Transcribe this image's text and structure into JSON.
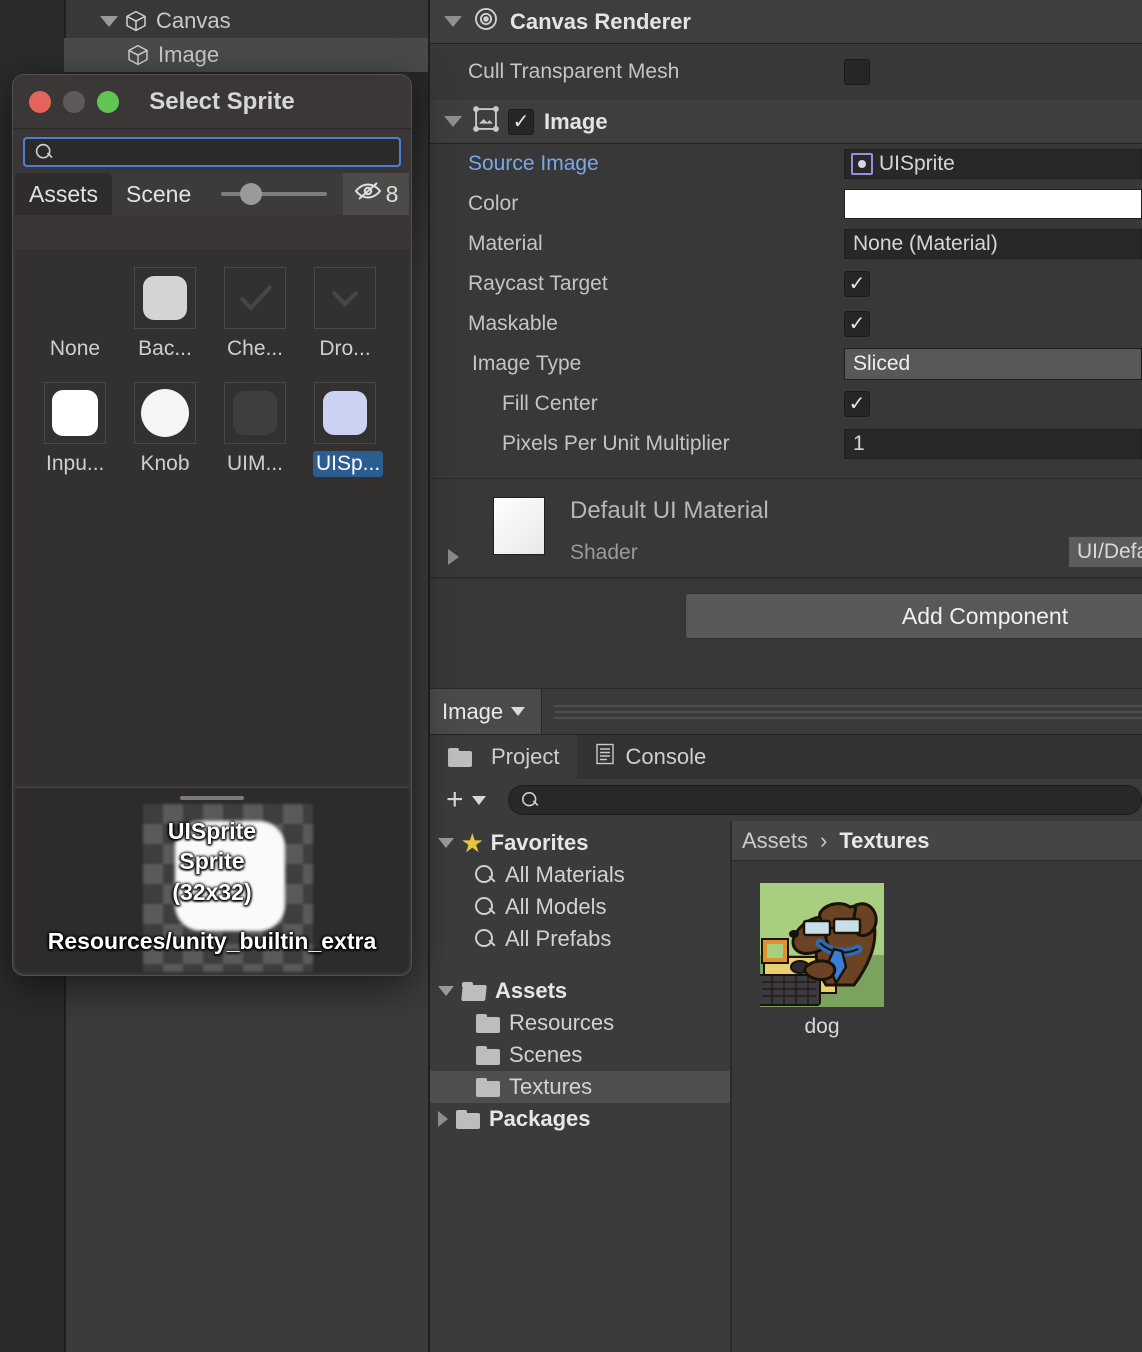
{
  "hierarchy": {
    "items": [
      {
        "label": "Canvas",
        "icon": "cube-icon",
        "expanded": true,
        "selected": false
      },
      {
        "label": "Image",
        "icon": "cube-icon",
        "expanded": false,
        "selected": true
      }
    ]
  },
  "inspector": {
    "canvas_renderer": {
      "title": "Canvas Renderer",
      "icon": "canvas-renderer-icon",
      "rows": [
        {
          "label": "Cull Transparent Mesh",
          "checked": false
        }
      ]
    },
    "image_component": {
      "title": "Image",
      "icon": "image-component-icon",
      "enabled": true,
      "source_image_label": "Source Image",
      "source_image_value": "UISprite",
      "color_label": "Color",
      "color_value": "#FFFFFF",
      "material_label": "Material",
      "material_value": "None (Material)",
      "raycast_target_label": "Raycast Target",
      "raycast_target_checked": true,
      "maskable_label": "Maskable",
      "maskable_checked": true,
      "image_type_label": "Image Type",
      "image_type_value": "Sliced",
      "fill_center_label": "Fill Center",
      "fill_center_checked": true,
      "ppu_label": "Pixels Per Unit Multiplier",
      "ppu_value": "1"
    },
    "material_preview": {
      "name": "Default UI Material",
      "shader_label": "Shader",
      "shader_value": "UI/Default"
    },
    "add_component_label": "Add Component",
    "footer_dropdown_label": "Image"
  },
  "project": {
    "tabs": [
      {
        "label": "Project",
        "icon": "folder-icon",
        "active": true
      },
      {
        "label": "Console",
        "icon": "console-icon",
        "active": false
      }
    ],
    "create_label": "+",
    "search_placeholder": "",
    "tree": [
      {
        "label": "Favorites",
        "icon": "star-icon",
        "arrow": "down",
        "indent": 0,
        "bold": true,
        "selected": false
      },
      {
        "label": "All Materials",
        "icon": "search-icon",
        "arrow": "none",
        "indent": 1,
        "bold": false,
        "selected": false
      },
      {
        "label": "All Models",
        "icon": "search-icon",
        "arrow": "none",
        "indent": 1,
        "bold": false,
        "selected": false
      },
      {
        "label": "All Prefabs",
        "icon": "search-icon",
        "arrow": "none",
        "indent": 1,
        "bold": false,
        "selected": false
      },
      {
        "label": "Assets",
        "icon": "folder-open-icon",
        "arrow": "down",
        "indent": 0,
        "bold": true,
        "selected": false
      },
      {
        "label": "Resources",
        "icon": "folder-icon",
        "arrow": "none",
        "indent": 1,
        "bold": false,
        "selected": false
      },
      {
        "label": "Scenes",
        "icon": "folder-icon",
        "arrow": "none",
        "indent": 1,
        "bold": false,
        "selected": false
      },
      {
        "label": "Textures",
        "icon": "folder-icon",
        "arrow": "none",
        "indent": 1,
        "bold": false,
        "selected": true
      },
      {
        "label": "Packages",
        "icon": "folder-icon",
        "arrow": "right",
        "indent": 0,
        "bold": true,
        "selected": false
      }
    ],
    "breadcrumb": {
      "root": "Assets",
      "separator": "›",
      "current": "Textures"
    },
    "assets": [
      {
        "name": "dog",
        "icon": "dog-thumbnail"
      }
    ]
  },
  "select_sprite_modal": {
    "title": "Select Sprite",
    "window_buttons": [
      {
        "name": "close",
        "color": "#e3655c"
      },
      {
        "name": "minimize",
        "color": "#5e5a5a"
      },
      {
        "name": "zoom",
        "color": "#61c454"
      }
    ],
    "search_placeholder": "",
    "search_value": "",
    "tabs": [
      {
        "label": "Assets",
        "active": true
      },
      {
        "label": "Scene",
        "active": false
      }
    ],
    "hidden_count": "8",
    "hidden_icon": "eye-slash-icon",
    "sprites": [
      {
        "label": "None",
        "swatch": "none",
        "selected": false
      },
      {
        "label": "Bac...",
        "swatch": "#d4d4d4",
        "selected": false
      },
      {
        "label": "Che...",
        "swatch": "checkmark",
        "selected": false
      },
      {
        "label": "Dro...",
        "swatch": "chevron",
        "selected": false
      },
      {
        "label": "Inpu...",
        "swatch": "#ffffff",
        "selected": false
      },
      {
        "label": "Knob",
        "swatch": "circle-white",
        "selected": false
      },
      {
        "label": "UIM...",
        "swatch": "#3e3e3e",
        "selected": false
      },
      {
        "label": "UISp...",
        "swatch": "#ccd3f2",
        "selected": true
      }
    ],
    "preview": {
      "name": "UISprite",
      "type": "Sprite",
      "dimensions": "(32x32)",
      "path": "Resources/unity_builtin_extra"
    }
  }
}
